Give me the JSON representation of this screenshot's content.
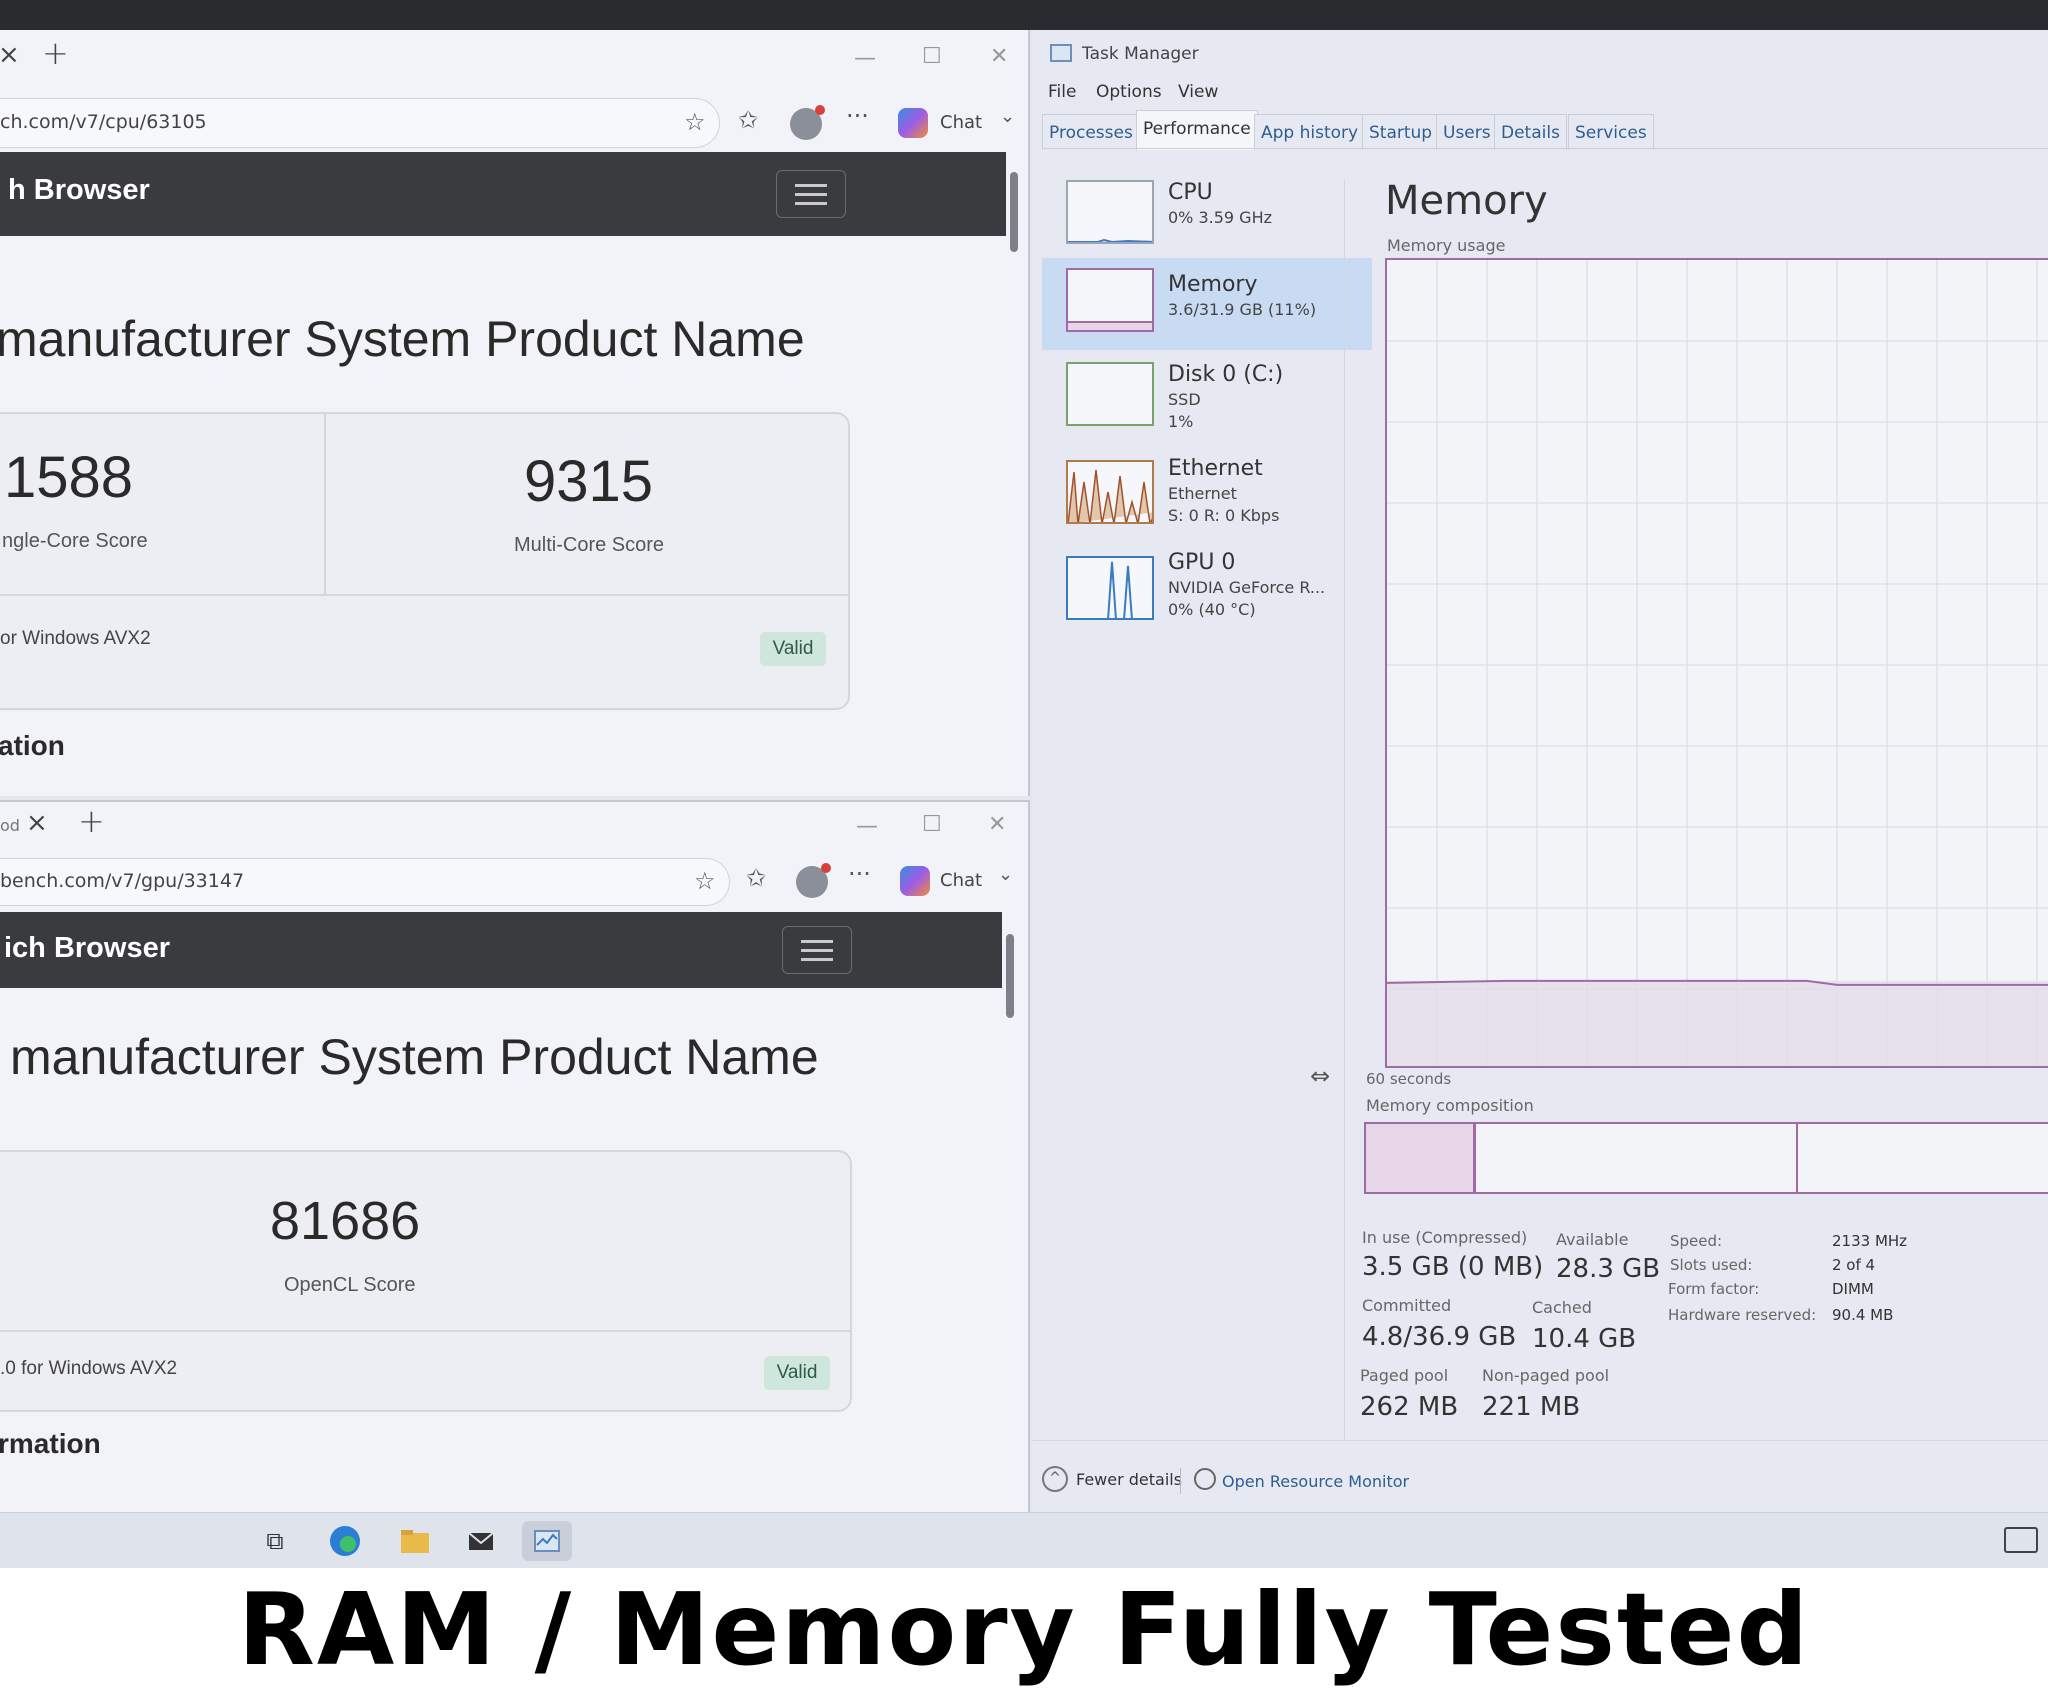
{
  "browser_top": {
    "url": "ch.com/v7/cpu/63105",
    "chat_label": "Chat",
    "site_title": "h Browser",
    "product_name": "manufacturer System Product Name",
    "score1": "1588",
    "score1_label": "ngle-Core Score",
    "score2": "9315",
    "score2_label": "Multi-Core Score",
    "platform": "or Windows AVX2",
    "valid": "Valid",
    "section": "ation"
  },
  "browser_bottom": {
    "tab_fragment": "od",
    "url": "bench.com/v7/gpu/33147",
    "chat_label": "Chat",
    "site_title": "ich Browser",
    "product_name": "manufacturer System Product Name",
    "score": "81686",
    "score_label": "OpenCL Score",
    "platform": ".0 for Windows AVX2",
    "valid": "Valid",
    "section": "rmation"
  },
  "task_manager": {
    "title": "Task Manager",
    "menu": [
      "File",
      "Options",
      "View"
    ],
    "tabs": [
      "Processes",
      "Performance",
      "App history",
      "Startup",
      "Users",
      "Details",
      "Services"
    ],
    "active_tab": "Performance",
    "sidebar": [
      {
        "name": "CPU",
        "sub1": "0%  3.59 GHz",
        "sub2": ""
      },
      {
        "name": "Memory",
        "sub1": "3.6/31.9 GB (11%)",
        "sub2": ""
      },
      {
        "name": "Disk 0 (C:)",
        "sub1": "SSD",
        "sub2": "1%"
      },
      {
        "name": "Ethernet",
        "sub1": "Ethernet",
        "sub2": "S: 0  R: 0 Kbps"
      },
      {
        "name": "GPU 0",
        "sub1": "NVIDIA GeForce R...",
        "sub2": "0%  (40 °C)"
      }
    ],
    "heading": "Memory",
    "usage_label": "Memory usage",
    "usage_fraction": 0.11,
    "time_label": "60 seconds",
    "composition_label": "Memory composition",
    "stats": {
      "in_use_label": "In use (Compressed)",
      "in_use": "3.5 GB (0 MB)",
      "available_label": "Available",
      "available": "28.3 GB",
      "committed_label": "Committed",
      "committed": "4.8/36.9 GB",
      "cached_label": "Cached",
      "cached": "10.4 GB",
      "paged_label": "Paged pool",
      "paged": "262 MB",
      "nonpaged_label": "Non-paged pool",
      "nonpaged": "221 MB"
    },
    "specs": {
      "speed_label": "Speed:",
      "speed": "2133 MHz",
      "slots_label": "Slots used:",
      "slots": "2 of 4",
      "form_label": "Form factor:",
      "form": "DIMM",
      "reserved_label": "Hardware reserved:",
      "reserved": "90.4 MB"
    },
    "fewer_details": "Fewer details",
    "open_resource_monitor": "Open Resource Monitor"
  },
  "caption": "RAM / Memory Fully Tested",
  "colors": {
    "memory_accent": "#a06aa6",
    "selected_sidebar": "#c9dbf2",
    "link_blue": "#2f5d91",
    "site_header": "#3a3b3e",
    "valid_badge": "#cfe6dc"
  }
}
